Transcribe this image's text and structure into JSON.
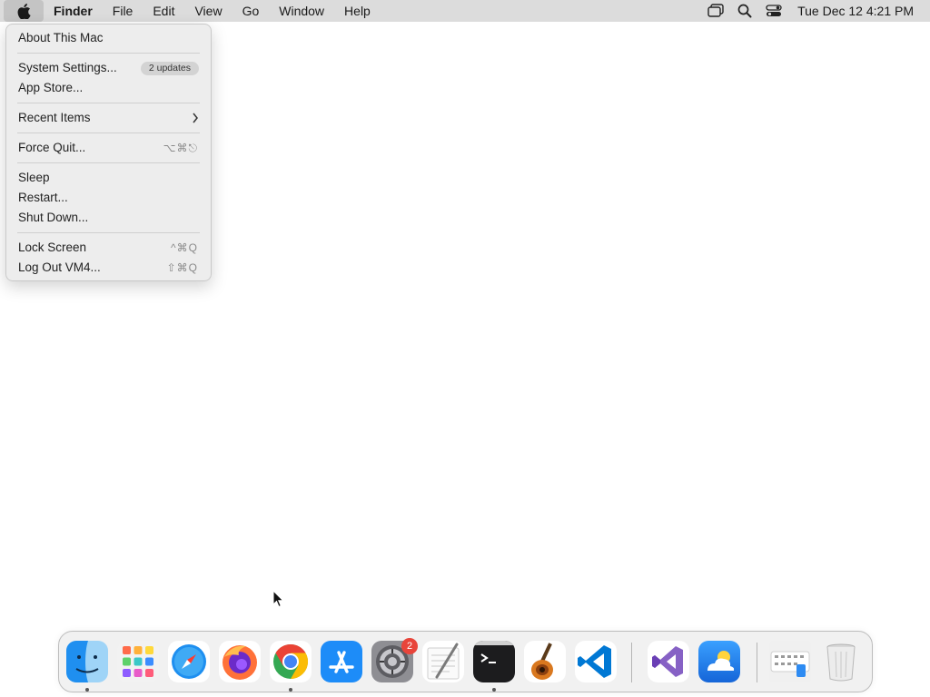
{
  "menubar": {
    "apple_icon": "apple-logo-icon",
    "items": [
      "Finder",
      "File",
      "Edit",
      "View",
      "Go",
      "Window",
      "Help"
    ],
    "status_icons": [
      "screen-mirroring-icon",
      "spotlight-search-icon",
      "control-center-icon"
    ],
    "clock": "Tue Dec 12  4:21 PM"
  },
  "apple_menu": {
    "about": "About This Mac",
    "system_settings": "System Settings...",
    "updates_badge": "2 updates",
    "app_store": "App Store...",
    "recent_items": "Recent Items",
    "force_quit": "Force Quit...",
    "force_quit_shortcut": "⌥⌘⎋",
    "sleep": "Sleep",
    "restart": "Restart...",
    "shut_down": "Shut Down...",
    "lock_screen": "Lock Screen",
    "lock_screen_shortcut": "^⌘Q",
    "log_out": "Log Out VM4...",
    "log_out_shortcut": "⇧⌘Q"
  },
  "dock": {
    "apps": [
      "Finder",
      "Launchpad",
      "Safari",
      "Firefox",
      "Google Chrome",
      "App Store",
      "System Settings",
      "TextEdit",
      "Terminal",
      "GarageBand",
      "Visual Studio Code",
      "Visual Studio",
      "Weather",
      "Downloads",
      "Trash"
    ],
    "system_settings_badge": "2"
  },
  "colors": {
    "menubar_bg": "#dcdcdc",
    "menu_bg": "#ececec",
    "badge_red": "#e8443a"
  }
}
